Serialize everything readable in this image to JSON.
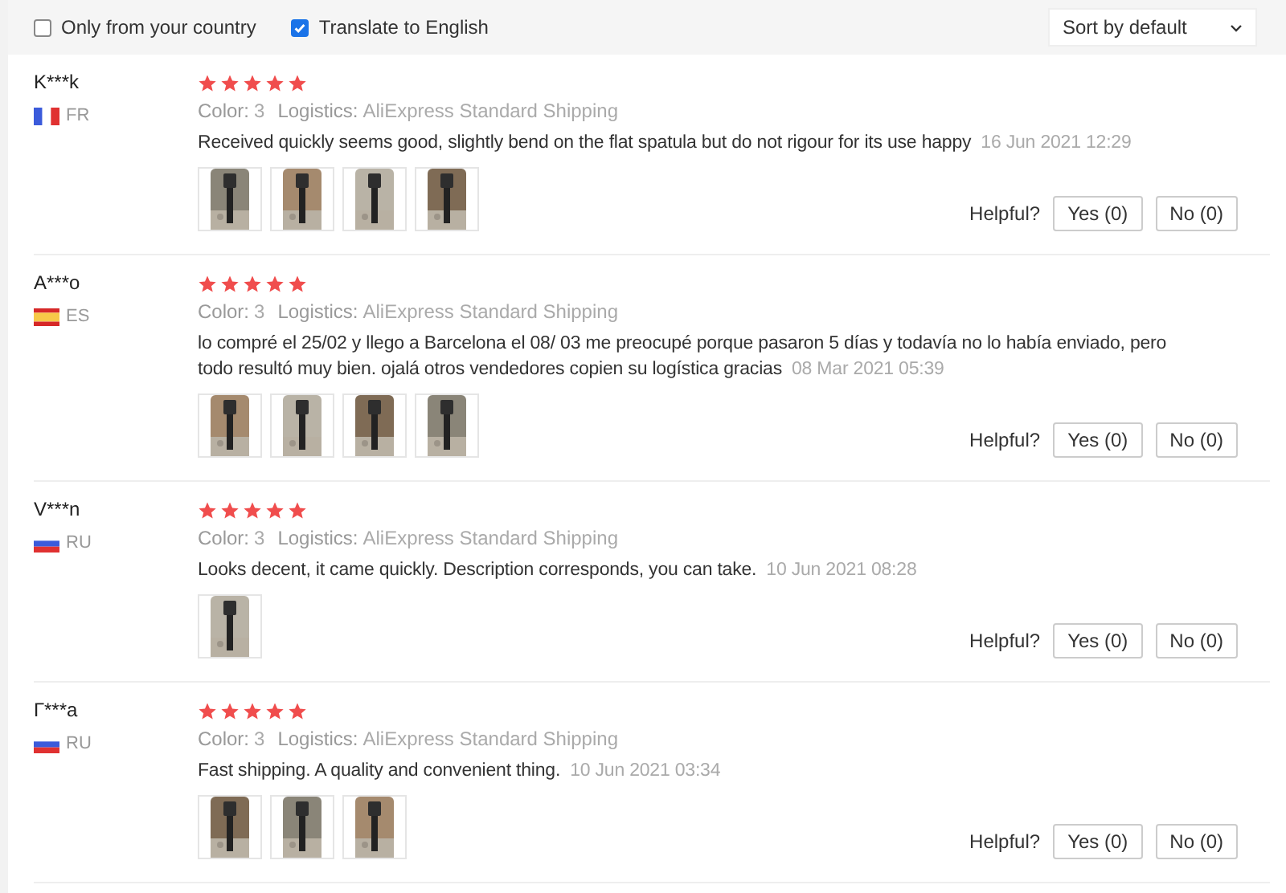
{
  "filters": [
    {
      "label": "Only from your country",
      "checked": false
    },
    {
      "label": "Translate to English",
      "checked": true
    }
  ],
  "sort": {
    "value": "Sort by default"
  },
  "reviews": [
    {
      "author": "K***k",
      "flag": {
        "kind": "fr"
      },
      "country": "FR",
      "stars": 5,
      "color_label": "Color:",
      "color_value": "3",
      "logistics_label": "Logistics:",
      "logistics_value": "AliExpress Standard Shipping",
      "comment": "Received quickly seems good, slightly bend on the flat spatula but do not rigour for its use happy",
      "date": "16 Jun 2021 12:29",
      "photos": [
        {
          "kind": "picture"
        },
        {
          "kind": "picture"
        },
        {
          "kind": "picture"
        },
        {
          "kind": "picture"
        }
      ],
      "helpful_label": "Helpful?",
      "yes": "Yes (0)",
      "no": "No (0)"
    },
    {
      "author": "A***o",
      "flag": {
        "kind": "es"
      },
      "country": "ES",
      "stars": 5,
      "color_label": "Color:",
      "color_value": "3",
      "logistics_label": "Logistics:",
      "logistics_value": "AliExpress Standard Shipping",
      "comment": "lo compré el 25/02 y llego a Barcelona el 08/ 03 me preocupé porque pasaron 5 días y todavía no lo había enviado, pero todo resultó muy bien. ojalá otros vendedores copien su logística gracias",
      "date": "08 Mar 2021 05:39",
      "photos": [
        {
          "kind": "picture"
        },
        {
          "kind": "picture"
        },
        {
          "kind": "picture"
        },
        {
          "kind": "picture"
        }
      ],
      "helpful_label": "Helpful?",
      "yes": "Yes (0)",
      "no": "No (0)"
    },
    {
      "author": "V***n",
      "flag": {
        "kind": "ru"
      },
      "country": "RU",
      "stars": 5,
      "color_label": "Color:",
      "color_value": "3",
      "logistics_label": "Logistics:",
      "logistics_value": "AliExpress Standard Shipping",
      "comment": "Looks decent, it came quickly. Description corresponds, you can take.",
      "date": "10 Jun 2021 08:28",
      "photos": [
        {
          "kind": "picture"
        }
      ],
      "helpful_label": "Helpful?",
      "yes": "Yes (0)",
      "no": "No (0)"
    },
    {
      "author": "Г***a",
      "flag": {
        "kind": "ru"
      },
      "country": "RU",
      "stars": 5,
      "color_label": "Color:",
      "color_value": "3",
      "logistics_label": "Logistics:",
      "logistics_value": "AliExpress Standard Shipping",
      "comment": "Fast shipping. A quality and convenient thing.",
      "date": "10 Jun 2021 03:34",
      "photos": [
        {
          "kind": "picture"
        },
        {
          "kind": "picture"
        },
        {
          "kind": "picture"
        }
      ],
      "helpful_label": "Helpful?",
      "yes": "Yes (0)",
      "no": "No (0)"
    }
  ]
}
